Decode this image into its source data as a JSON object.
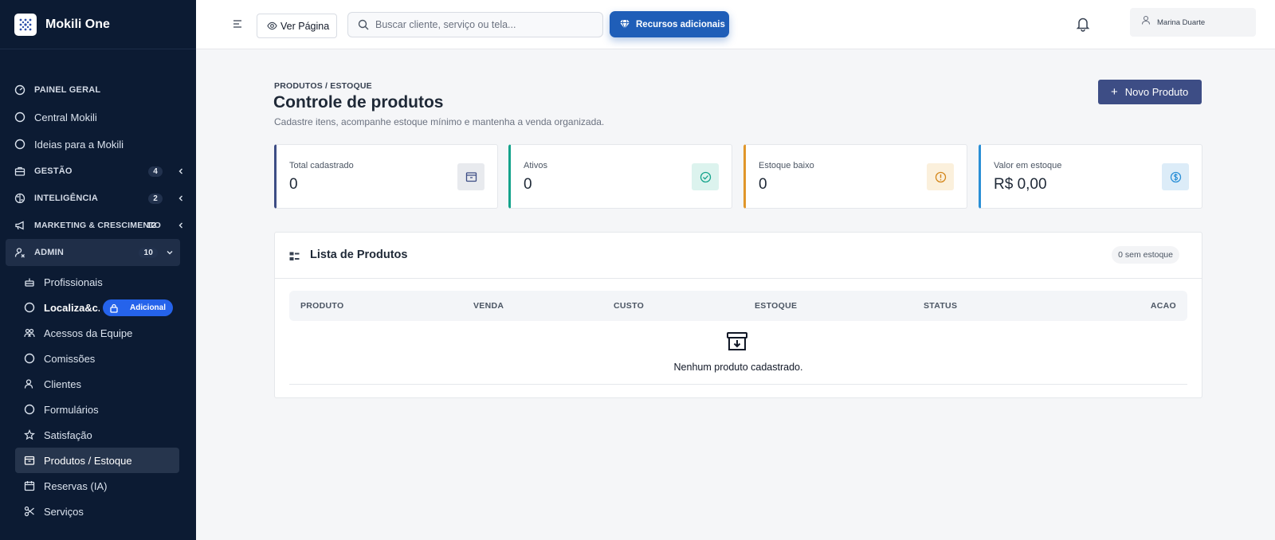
{
  "brand": {
    "name": "Mokili One"
  },
  "nav": {
    "painel": "PAINEL GERAL",
    "central": "Central Mokili",
    "ideias": "Ideias para a Mokili",
    "gestao": {
      "label": "GESTÃO",
      "count": "4"
    },
    "inteligencia": {
      "label": "INTELIGÊNCIA",
      "count": "2"
    },
    "marketing": {
      "label": "MARKETING & CRESCIMENTO",
      "count": "12"
    },
    "admin": {
      "label": "ADMIN",
      "count": "10"
    }
  },
  "admin_items": {
    "profissionais": "Profissionais",
    "localizacao": "Localiza&c...",
    "adicional_badge": "Adicional",
    "acessos": "Acessos da Equipe",
    "comissoes": "Comissões",
    "clientes": "Clientes",
    "formularios": "Formulários",
    "satisfacao": "Satisfação",
    "produtos": "Produtos / Estoque",
    "reservas": "Reservas (IA)",
    "servicos": "Serviços"
  },
  "topbar": {
    "view_page": "Ver Página",
    "search_placeholder": "Buscar cliente, serviço ou tela...",
    "recursos": "Recursos adicionais",
    "user_name": "Marina Duarte"
  },
  "page": {
    "breadcrumb": "PRODUTOS / ESTOQUE",
    "title": "Controle de produtos",
    "subtitle": "Cadastre itens, acompanhe estoque mínimo e mantenha a venda organizada.",
    "new_button": "Novo Produto"
  },
  "stats": [
    {
      "label": "Total cadastrado",
      "value": "0",
      "color": "#3d4d85"
    },
    {
      "label": "Ativos",
      "value": "0",
      "color": "#14a38b"
    },
    {
      "label": "Estoque baixo",
      "value": "0",
      "color": "#e0962a"
    },
    {
      "label": "Valor em estoque",
      "value": "R$ 0,00",
      "color": "#2a8fd6"
    }
  ],
  "list": {
    "title": "Lista de Produtos",
    "pill": "0 sem estoque",
    "columns": [
      "PRODUTO",
      "VENDA",
      "CUSTO",
      "ESTOQUE",
      "STATUS",
      "ACAO"
    ],
    "empty": "Nenhum produto cadastrado."
  }
}
